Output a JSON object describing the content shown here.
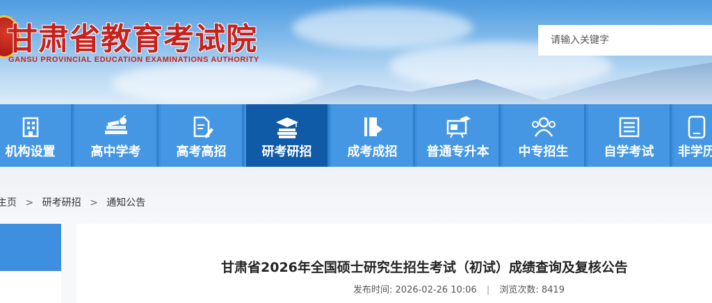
{
  "header": {
    "title": "甘肃省教育考试院",
    "subtitle": "GANSU PROVINCIAL EDUCATION EXAMINATIONS AUTHORITY",
    "search_placeholder": "请输入关键字",
    "brand_color": "#c8211b"
  },
  "nav": {
    "items": [
      {
        "label": "机构设置",
        "icon": "building-icon"
      },
      {
        "label": "高中学考",
        "icon": "books-apple-icon"
      },
      {
        "label": "高考高招",
        "icon": "document-pen-icon"
      },
      {
        "label": "研考研招",
        "icon": "graduation-cap-icon",
        "active": true
      },
      {
        "label": "成考成招",
        "icon": "book-icon"
      },
      {
        "label": "普通专升本",
        "icon": "presentation-icon"
      },
      {
        "label": "中专招生",
        "icon": "people-icon"
      },
      {
        "label": "自学考试",
        "icon": "notebook-icon"
      },
      {
        "label": "非学历",
        "icon": "phone-icon"
      }
    ],
    "color": "#4597e3",
    "active_color": "#0f5ba8"
  },
  "breadcrumb": {
    "items": [
      "主页",
      "研考研招",
      "通知公告"
    ],
    "separator": ">"
  },
  "article": {
    "title": "甘肃省2026年全国硕士研究生招生考试（初试）成绩查询及复核公告",
    "published_label": "发布时间:",
    "published_value": "2026-02-26 10:06",
    "meta_separator": "|",
    "views_label": "浏览次数:",
    "views_value": "8419"
  }
}
